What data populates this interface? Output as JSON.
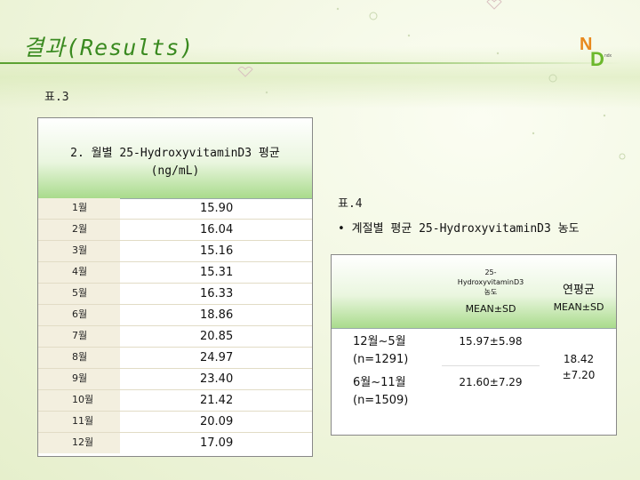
{
  "header": {
    "title": "결과(Results)"
  },
  "logo": {
    "letters": [
      "N",
      "D"
    ],
    "small_text": "ndx"
  },
  "left": {
    "caption": "표.3",
    "table": {
      "header_line1": "2. 월별 25-HydroxyvitaminD3  평균",
      "header_line2": "(ng/mL)",
      "rows": [
        {
          "month": "1월",
          "value": "15.90"
        },
        {
          "month": "2월",
          "value": "16.04"
        },
        {
          "month": "3월",
          "value": "15.16"
        },
        {
          "month": "4월",
          "value": "15.31"
        },
        {
          "month": "5월",
          "value": "16.33"
        },
        {
          "month": "6월",
          "value": "18.86"
        },
        {
          "month": "7월",
          "value": "20.85"
        },
        {
          "month": "8월",
          "value": "24.97"
        },
        {
          "month": "9월",
          "value": "23.40"
        },
        {
          "month": "10월",
          "value": "21.42"
        },
        {
          "month": "11월",
          "value": "20.09"
        },
        {
          "month": "12월",
          "value": "17.09"
        }
      ]
    }
  },
  "right": {
    "caption": "표.4",
    "bullet": "• 계절별 평균 25-HydroxyvitaminD3 농도",
    "table": {
      "col_header_line1": "25-",
      "col_header_line2": "HydroxyvitaminD3",
      "col_header_line3": "농도",
      "col_sub": "MEAN±SD",
      "annual_header": "연평균",
      "annual_sub": "MEAN±SD",
      "rows": [
        {
          "period": "12월~5월",
          "n": "(n=1291)",
          "value": "15.97±5.98"
        },
        {
          "period": "6월~11월",
          "n": "(n=1509)",
          "value": "21.60±7.29"
        }
      ],
      "annual_value_line1": "18.42",
      "annual_value_line2": "±7.20"
    }
  },
  "colors": {
    "title_green": "#3a8a20",
    "header_gradient_end": "#a9db8c",
    "month_cell_bg": "#f3efdf"
  }
}
